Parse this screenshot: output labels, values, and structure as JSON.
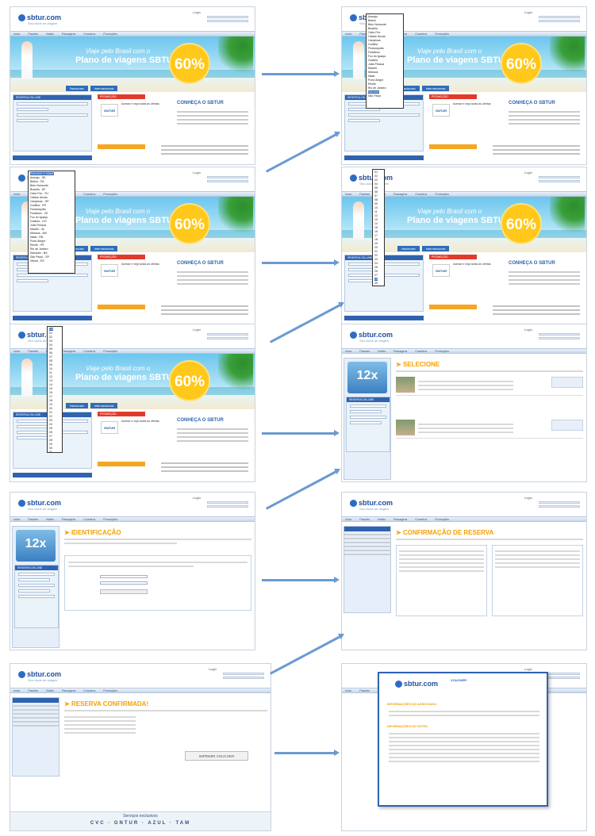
{
  "steps": [
    {
      "id": "s1",
      "title": "Home page"
    },
    {
      "id": "s2",
      "title": "Home page with destination dropdown"
    },
    {
      "id": "s3",
      "title": "Home page with origin dropdown"
    },
    {
      "id": "s4",
      "title": "Home page with day dropdown"
    },
    {
      "id": "s5",
      "title": "Home page with return day dropdown"
    },
    {
      "id": "s6",
      "title": "Search results"
    },
    {
      "id": "s7",
      "title": "Identification"
    },
    {
      "id": "s8",
      "title": "Reservation confirmation"
    },
    {
      "id": "s9",
      "title": "Reservation confirmed"
    },
    {
      "id": "s10",
      "title": "Voucher popup"
    }
  ],
  "logo_text": "sbtur.com",
  "logo_tagline": "Seu clube de viagem",
  "banner_line1": "Viaje pelo Brasil com o",
  "banner_line2": "Plano de viagens SBTUR",
  "banner_discount": "60%",
  "banner_tabs": [
    "Nacionais",
    "Internacionais"
  ],
  "promo_label": "PROMOÇÃO",
  "promo_card": "GNTUR",
  "promo_head": "CONHEÇA O SBTUR",
  "box_label": "RESERVA ON-LINE",
  "side_badge": "12x",
  "page_titles": {
    "selecione": "SELECIONE",
    "identificacao": "IDENTIFICAÇÃO",
    "confirmacao": "CONFIRMAÇÃO DE RESERVA",
    "confirmada": "RESERVA CONFIRMADA!"
  },
  "voucher_button": "IMPRIMIR VOUCHER",
  "popup_sections": [
    "INFORMAÇÕES DO ASSOCIADO",
    "INFORMAÇÕES DO HOTEL"
  ],
  "footer_text": "Serviços exclusivos"
}
